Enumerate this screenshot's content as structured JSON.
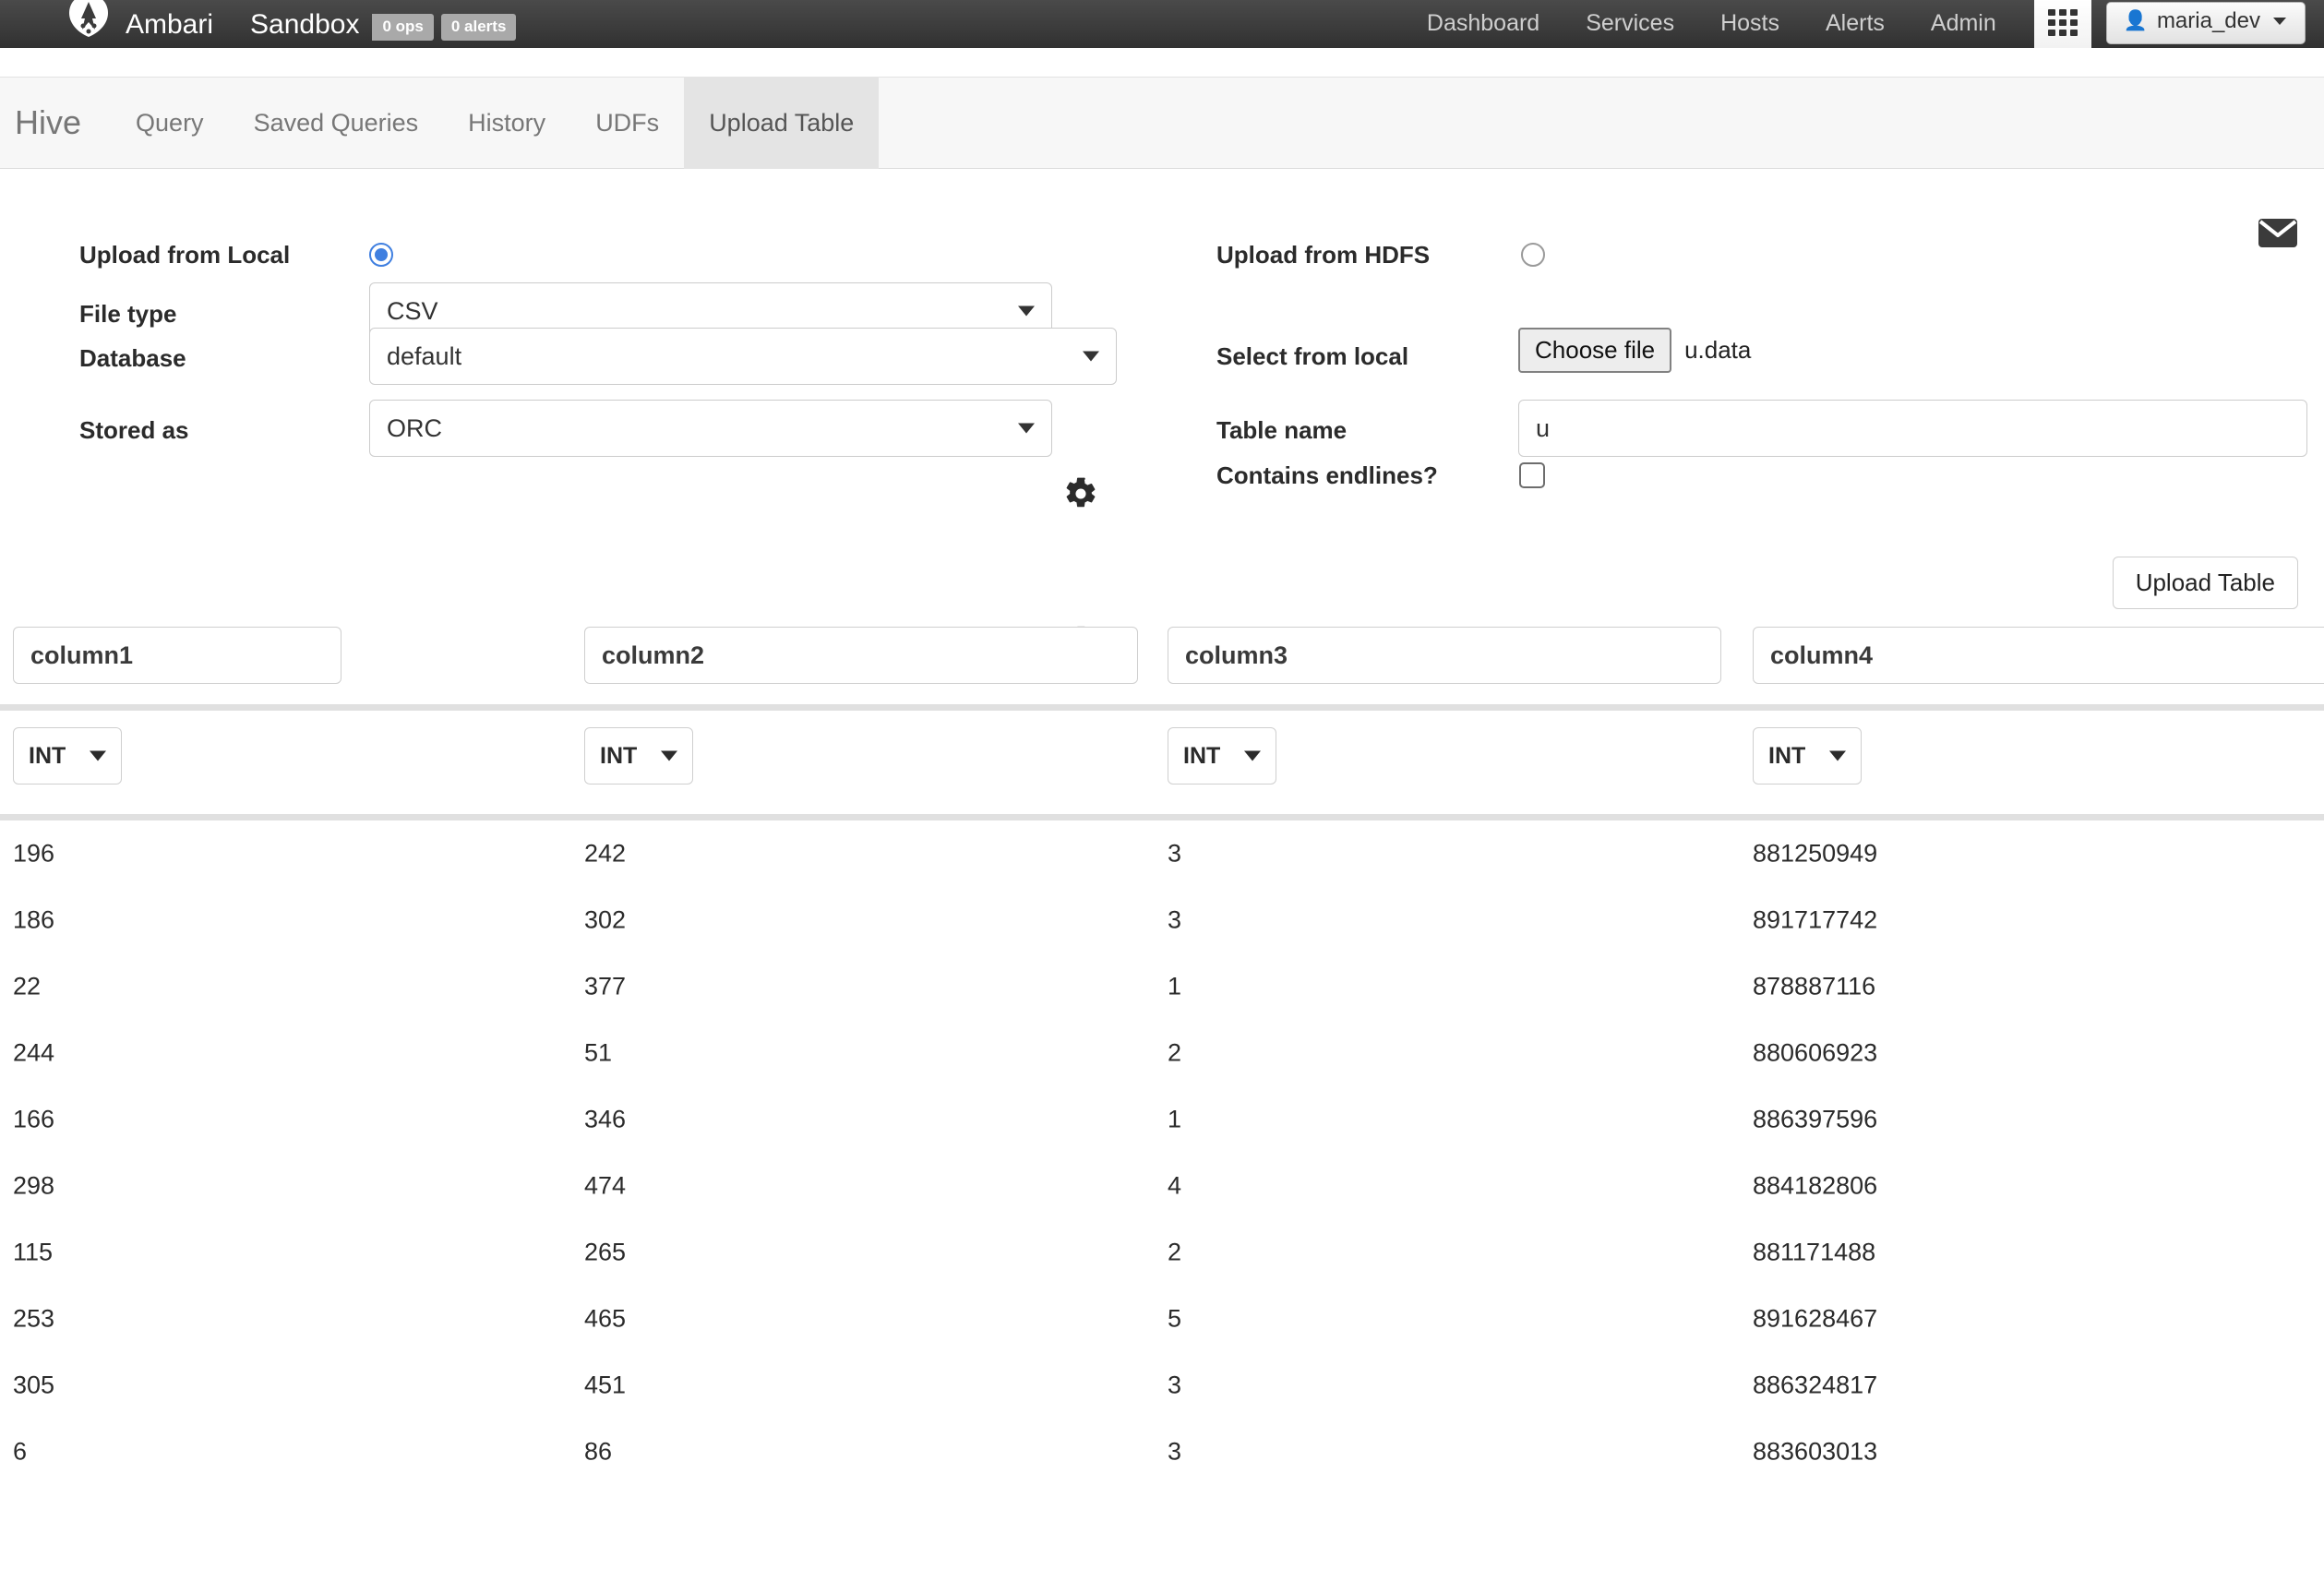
{
  "topbar": {
    "brand": "Ambari",
    "cluster": "Sandbox",
    "ops_badge": "0 ops",
    "alerts_badge": "0 alerts",
    "nav": [
      {
        "label": "Dashboard"
      },
      {
        "label": "Services"
      },
      {
        "label": "Hosts"
      },
      {
        "label": "Alerts"
      },
      {
        "label": "Admin"
      }
    ],
    "views_icon": "grid-icon",
    "user": "maria_dev"
  },
  "tabbar": {
    "title": "Hive",
    "tabs": [
      {
        "label": "Query",
        "active": false
      },
      {
        "label": "Saved Queries",
        "active": false
      },
      {
        "label": "History",
        "active": false
      },
      {
        "label": "UDFs",
        "active": false
      },
      {
        "label": "Upload Table",
        "active": true
      }
    ]
  },
  "form": {
    "mail_icon": "envelope-icon",
    "left": {
      "upload_local_label": "Upload from Local",
      "upload_local_selected": true,
      "file_type_label": "File type",
      "file_type_value": "CSV",
      "file_type_gear": "gear-icon",
      "database_label": "Database",
      "database_value": "default",
      "stored_as_label": "Stored as",
      "stored_as_value": "ORC",
      "stored_as_gear": "gear-icon-disabled"
    },
    "right": {
      "upload_hdfs_label": "Upload from HDFS",
      "upload_hdfs_selected": false,
      "select_local_label": "Select from local",
      "choose_file_label": "Choose file",
      "chosen_file": "u.data",
      "table_name_label": "Table name",
      "table_name_value": "u",
      "contains_endlines_label": "Contains endlines?",
      "contains_endlines_checked": false
    }
  },
  "actions": {
    "upload_table_label": "Upload Table"
  },
  "preview": {
    "columns": [
      {
        "name": "column1",
        "type": "INT"
      },
      {
        "name": "column2",
        "type": "INT"
      },
      {
        "name": "column3",
        "type": "INT"
      },
      {
        "name": "column4",
        "type": "INT"
      }
    ],
    "rows": [
      [
        "196",
        "242",
        "3",
        "881250949"
      ],
      [
        "186",
        "302",
        "3",
        "891717742"
      ],
      [
        "22",
        "377",
        "1",
        "878887116"
      ],
      [
        "244",
        "51",
        "2",
        "880606923"
      ],
      [
        "166",
        "346",
        "1",
        "886397596"
      ],
      [
        "298",
        "474",
        "4",
        "884182806"
      ],
      [
        "115",
        "265",
        "2",
        "881171488"
      ],
      [
        "253",
        "465",
        "5",
        "891628467"
      ],
      [
        "305",
        "451",
        "3",
        "886324817"
      ],
      [
        "6",
        "86",
        "3",
        "883603013"
      ]
    ]
  },
  "colors": {
    "accent_blue": "#3f7fe0",
    "topbar_dark": "#3b3b3b",
    "tab_active": "#e4e4e4",
    "rule_gray": "#e0e0e0"
  }
}
